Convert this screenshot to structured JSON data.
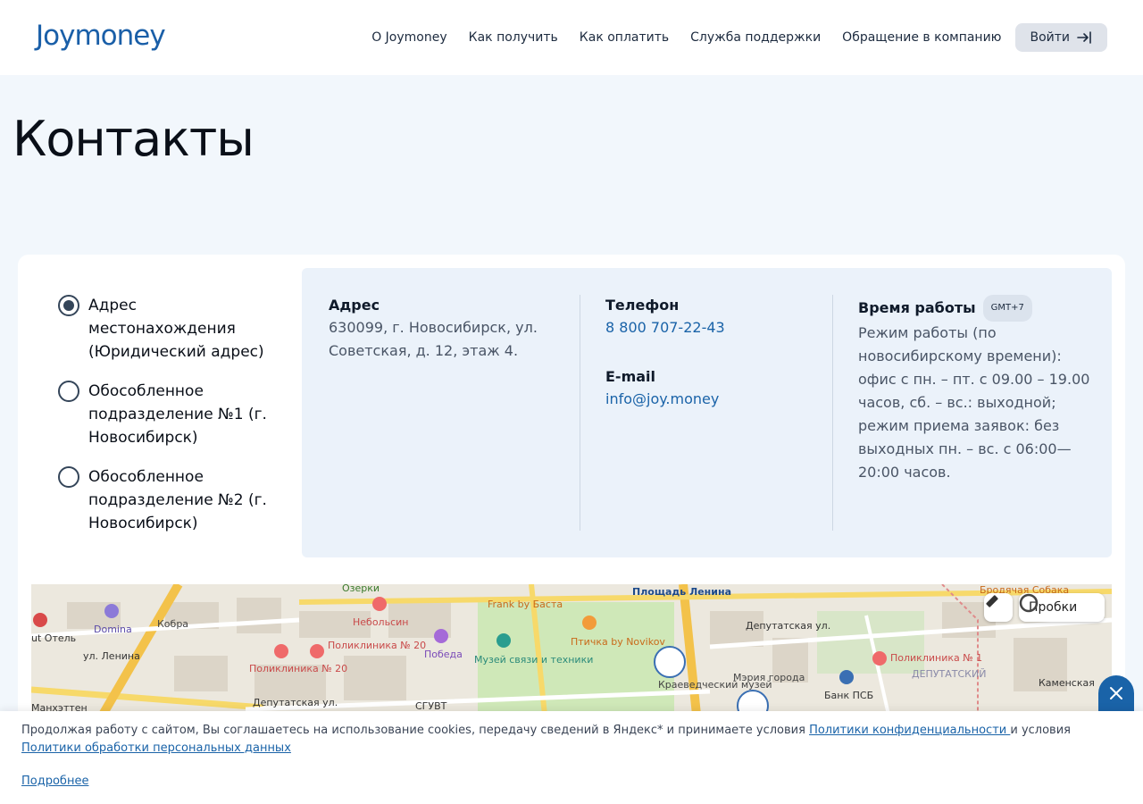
{
  "header": {
    "logo": "Joymoney",
    "nav": [
      "О Joymoney",
      "Как получить",
      "Как оплатить",
      "Служба поддержки",
      "Обращение в компанию"
    ],
    "login_label": "Войти"
  },
  "page_title": "Контакты",
  "addresses": [
    {
      "label": "Адрес местонахождения (Юридический адрес)",
      "selected": true
    },
    {
      "label": "Обособленное подразделение №1 (г. Новосибирск)",
      "selected": false
    },
    {
      "label": "Обособленное подразделение №2 (г. Новосибирск)",
      "selected": false
    }
  ],
  "info": {
    "address_title": "Адрес",
    "address_text": "630099, г. Новосибирск, ул. Советская, д. 12, этаж 4.",
    "phone_title": "Телефон",
    "phone_value": "8 800 707-22-43",
    "email_title": "E-mail",
    "email_value": "info@joy.money",
    "hours_title": "Время работы",
    "hours_badge": "GMT+7",
    "hours_text": "Режим работы (по новосибирскому времени): офис с пн. – пт. с 09.00 – 19.00 часов, сб. – вс.: выходной; режим приема заявок: без выходных пн. – вс. с 06:00—20:00 часов."
  },
  "map": {
    "labels": [
      "Озерки",
      "Площадь Ленина",
      "Бродячая Собака",
      "Frank by Баста",
      "Небольсин",
      "Domina",
      "Кобра",
      "ut Отель",
      "ул. Ленина",
      "Поликлиника № 20",
      "Поликлиника № 20",
      "Победа",
      "Музей связи и техники",
      "Птичка by Novikov",
      "Краеведческий музей",
      "Мэрия города",
      "Банк ПСБ",
      "Депутатская ул.",
      "Поликлиника № 1",
      "ДЕПУТАТСКИЙ",
      "СГУВТ",
      "Депутатская ул.",
      "Манхэттен",
      "Каменская"
    ],
    "traffic_label": "Пробки"
  },
  "cookie": {
    "text_before": "Продолжая работу с сайтом, Вы соглашаетесь на использование cookies, передачу сведений в Яндекс* и принимаете условия ",
    "link1": "Политики конфиденциальности ",
    "text_middle": "и условия ",
    "link2": "Политики обработки персональных данных",
    "more": "Подробнее"
  },
  "colors": {
    "accent": "#1a63a8",
    "page_bg": "#f2f7fc",
    "panel_bg": "#ebf2fa"
  }
}
